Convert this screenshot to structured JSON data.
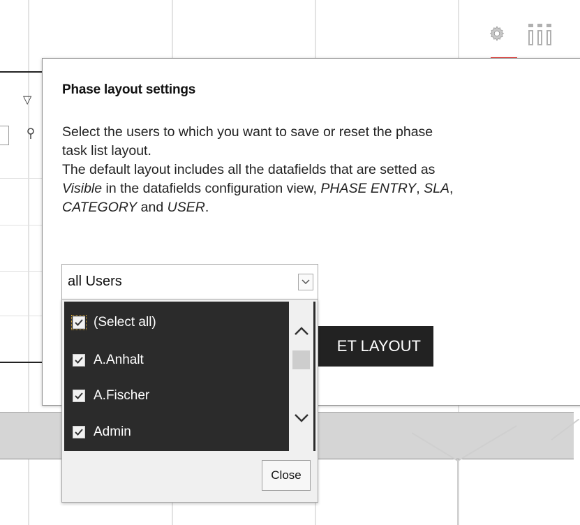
{
  "toolbar": {
    "settings_icon": "gear-icon",
    "columns_icon": "columns-icon",
    "active_color": "#e53935"
  },
  "popup": {
    "title": "Phase layout settings",
    "desc_line1": "Select the users to which you want to save or reset the phase",
    "desc_line2": "task list layout.",
    "desc_line3": "The default layout includes all the datafields that are setted as",
    "desc_visible": "Visible",
    "desc_line4_mid": " in the datafields configuration view, ",
    "desc_phase_entry": "PHASE ENTRY",
    "desc_sep1": ", ",
    "desc_sla": "SLA",
    "desc_sep2": ",",
    "desc_category": "CATEGORY",
    "desc_and": " and ",
    "desc_user": "USER",
    "desc_end": ".",
    "reset_label": "ET LAYOUT"
  },
  "user_select": {
    "value": "all Users",
    "options": [
      {
        "label": "(Select all)",
        "checked": true
      },
      {
        "label": "A.Anhalt",
        "checked": true
      },
      {
        "label": "A.Fischer",
        "checked": true
      },
      {
        "label": "Admin",
        "checked": true
      }
    ],
    "close_label": "Close"
  }
}
